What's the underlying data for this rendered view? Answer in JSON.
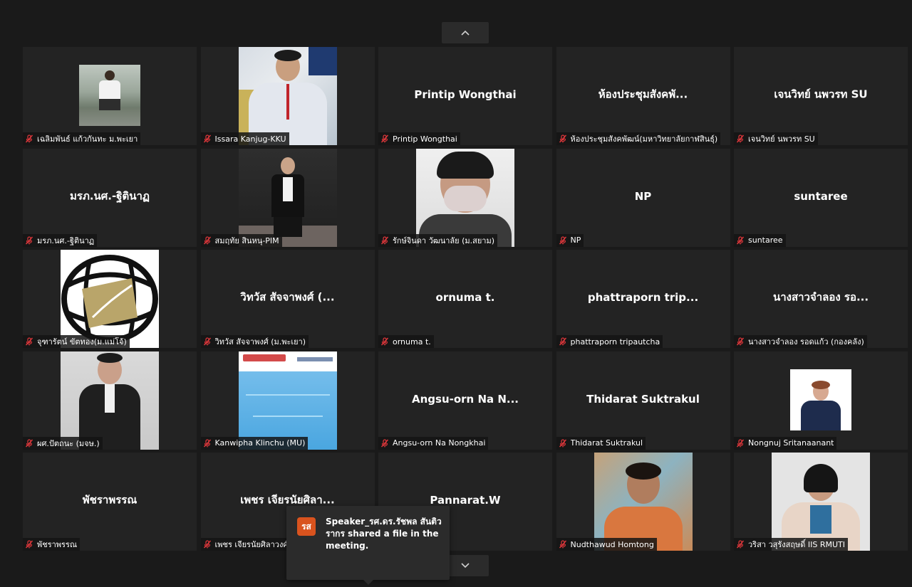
{
  "navigation": {
    "up_icon": "chevron-up-icon",
    "down_icon": "chevron-down-icon"
  },
  "participants": [
    {
      "display": "",
      "label": "เฉลิมพันธ์ แก้วกันทะ ม.พะเยา",
      "photo": "outdoor-small"
    },
    {
      "display": "",
      "label": "Issara Kanjug-KKU",
      "photo": "lanyard"
    },
    {
      "display": "Printip Wongthai",
      "label": "Printip Wongthai",
      "photo": ""
    },
    {
      "display": "ห้องประชุมสังคพั...",
      "label": "ห้องประชุมสังคพัฒน์(มหาวิทยาลัยกาฬสินธุ์)",
      "photo": ""
    },
    {
      "display": "เจนวิทย์ นพวรท SU",
      "label": "เจนวิทย์ นพวรท SU",
      "photo": ""
    },
    {
      "display": "มรภ.นศ.-ฐิตินาฏ",
      "label": "มรภ.นศ.-ฐิตินาฏ",
      "photo": ""
    },
    {
      "display": "",
      "label": "สมฤทัย สินหนุ-PIM",
      "photo": "dark"
    },
    {
      "display": "",
      "label": "รักษ์จินดา วัฒนาลัย (ม.สยาม)",
      "photo": "mask"
    },
    {
      "display": "NP",
      "label": "NP",
      "photo": ""
    },
    {
      "display": "suntaree",
      "label": "suntaree",
      "photo": ""
    },
    {
      "display": "",
      "label": "จุฑารัตน์ ขัตทอง(ม.แม่โจ้)",
      "photo": "logo"
    },
    {
      "display": "วิทวัส สัจจาพงศ์ (...",
      "label": "วิทวัส สัจจาพงศ์ (ม.พะเยา)",
      "photo": ""
    },
    {
      "display": "ornuma t.",
      "label": "ornuma t.",
      "photo": ""
    },
    {
      "display": "phattraporn trip...",
      "label": "phattraporn tripautcha",
      "photo": ""
    },
    {
      "display": "นางสาวจำลอง รอ...",
      "label": "นางสาวจำลอง รอดแก้ว (กองคลัง)",
      "photo": ""
    },
    {
      "display": "",
      "label": "ผศ.ปัตถนะ (มจษ.)",
      "photo": "suit"
    },
    {
      "display": "",
      "label": "Kanwipha Klinchu (MU)",
      "photo": "slide"
    },
    {
      "display": "Angsu-orn Na N...",
      "label": "Angsu-orn Na Nongkhai",
      "photo": ""
    },
    {
      "display": "Thidarat Suktrakul",
      "label": "Thidarat Suktrakul",
      "photo": ""
    },
    {
      "display": "",
      "label": "Nongnuj Sritanaanant",
      "photo": "white-small"
    },
    {
      "display": "พัชราพรรณ",
      "label": "พัชราพรรณ",
      "photo": ""
    },
    {
      "display": "เพชร เจียรนัยศิลา...",
      "label": "เพชร เจียรนัยศิลาวงศ์ (...",
      "photo": ""
    },
    {
      "display": "Pannarat.W",
      "label": "",
      "photo": ""
    },
    {
      "display": "",
      "label": "Nudthawud Homtong",
      "photo": "mural"
    },
    {
      "display": "",
      "label": "วริสา วสุรังสฤษดิ์ IIS RMUTI",
      "photo": "studio"
    }
  ],
  "toast": {
    "avatar_text": "รส",
    "message": "Speaker_รศ.ดร.รัชพล สันติวรากร shared a file in the meeting."
  },
  "colors": {
    "background": "#1a1a1a",
    "tile": "#232323",
    "mic_muted": "#e0373b",
    "toast_avatar": "#d9531e"
  }
}
